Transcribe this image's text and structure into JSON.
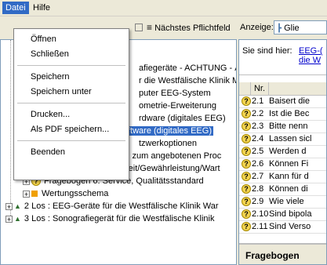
{
  "menubar": {
    "items": [
      {
        "label": "Datei"
      },
      {
        "label": "Hilfe"
      }
    ]
  },
  "file_menu": {
    "items": [
      {
        "label": "Öffnen"
      },
      {
        "label": "Schließen"
      },
      {
        "label": "Speichern"
      },
      {
        "label": "Speichern unter"
      },
      {
        "label": "Drucken..."
      },
      {
        "label": "Als PDF speichern..."
      },
      {
        "label": "Beenden"
      }
    ]
  },
  "toolbar": {
    "next_required_field": "Nächstes Pflichtfeld",
    "view_label": "Anzeige:",
    "view_value": "Glie"
  },
  "tree": {
    "items": [
      {
        "text": "afiegeräte - ACHTUNG - Änd"
      },
      {
        "text": "r die Westfälische Klinik Mars"
      },
      {
        "text": "puter EEG-System"
      },
      {
        "text": "ometrie-Erweiterung"
      },
      {
        "text": "rdware (digitales EEG)"
      },
      {
        "text": "ftware (digitales EEG)"
      },
      {
        "text": "tzwerkoptionen"
      },
      {
        "text": "Fragebogen 4: Fragen zum angebotenen Proc"
      },
      {
        "text": "Fragebogen 5: Lieferzeit/Gewährleistung/Wart"
      },
      {
        "text": "Fragebogen 6: Service, Qualitätsstandard"
      },
      {
        "text": "Wertungsschema"
      },
      {
        "text": "2 Los : EEG-Geräte für die Westfälische Klinik War"
      },
      {
        "text": "3 Los : Sonografiegerät für die Westfälische Klinik"
      }
    ]
  },
  "breadcrumb": {
    "label": "Sie sind hier:",
    "link1": "EEG-(",
    "link2": "die W"
  },
  "questions": {
    "header_nr": "Nr.",
    "rows": [
      {
        "nr": "2.1",
        "text": "Baisert die"
      },
      {
        "nr": "2.2",
        "text": "Ist die Bec"
      },
      {
        "nr": "2.3",
        "text": "Bitte nenn"
      },
      {
        "nr": "2.4",
        "text": "Lassen sicl"
      },
      {
        "nr": "2.5",
        "text": "Werden d"
      },
      {
        "nr": "2.6",
        "text": "Können Fi"
      },
      {
        "nr": "2.7",
        "text": "Kann für d"
      },
      {
        "nr": "2.8",
        "text": "Können di"
      },
      {
        "nr": "2.9",
        "text": "Wie viele"
      },
      {
        "nr": "2.10",
        "text": "Sind bipola"
      },
      {
        "nr": "2.11",
        "text": "Sind Verso"
      }
    ]
  },
  "bottom_panel": {
    "title": "Fragebogen"
  }
}
